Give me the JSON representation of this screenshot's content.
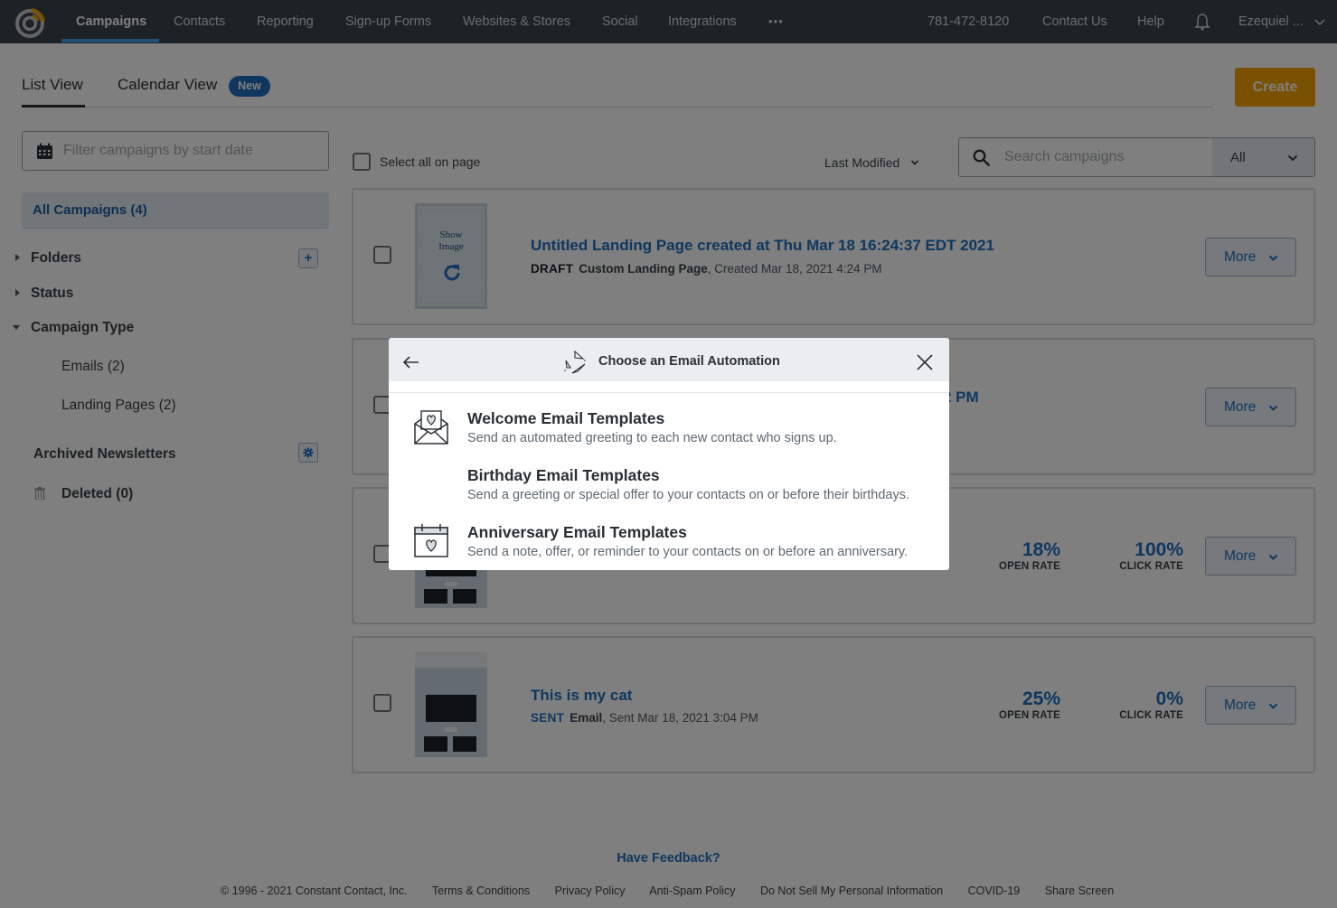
{
  "topnav": {
    "items": [
      "Campaigns",
      "Contacts",
      "Reporting",
      "Sign-up Forms",
      "Websites & Stores",
      "Social",
      "Integrations"
    ],
    "more_icon": "•••",
    "phone": "781-472-8120",
    "contact_us": "Contact Us",
    "help": "Help",
    "user": "Ezequiel ...",
    "active": "Campaigns"
  },
  "tabs": {
    "list_view": "List View",
    "calendar_view": "Calendar View",
    "new_badge": "New",
    "create": "Create"
  },
  "sidebar": {
    "date_filter_placeholder": "Filter campaigns by start date",
    "all_campaigns": "All Campaigns (4)",
    "folders": "Folders",
    "status": "Status",
    "campaign_type": "Campaign Type",
    "emails": "Emails (2)",
    "landing_pages": "Landing Pages (2)",
    "archived": "Archived Newsletters",
    "deleted": "Deleted (0)"
  },
  "list": {
    "select_all": "Select all on page",
    "sort": "Last Modified",
    "search_placeholder": "Search campaigns",
    "filter_value": "All",
    "campaigns": [
      {
        "title": "Untitled Landing Page created at Thu Mar 18 16:24:37 EDT 2021",
        "status": "DRAFT",
        "type": "Custom Landing Page",
        "date": ", Created Mar 18, 2021 4:24 PM",
        "thumb_text_1": "Show",
        "thumb_text_2": "Image",
        "more": "More"
      },
      {
        "title_visible_fragment": "2 PM",
        "more": "More"
      },
      {
        "open_rate": "18%",
        "open_rate_label": "OPEN RATE",
        "click_rate": "100%",
        "click_rate_label": "CLICK RATE",
        "more": "More"
      },
      {
        "title": "This is my cat",
        "status": "SENT",
        "type": "Email",
        "date": ", Sent Mar 18, 2021 3:04 PM",
        "open_rate": "25%",
        "open_rate_label": "OPEN RATE",
        "click_rate": "0%",
        "click_rate_label": "CLICK RATE",
        "more": "More"
      }
    ]
  },
  "footer": {
    "feedback": "Have Feedback?",
    "copyright": "© 1996 - 2021 Constant Contact, Inc.",
    "links": [
      "Terms & Conditions",
      "Privacy Policy",
      "Anti-Spam Policy",
      "Do Not Sell My Personal Information",
      "COVID-19",
      "Share Screen"
    ]
  },
  "modal": {
    "title": "Choose an Email Automation",
    "items": [
      {
        "title": "Welcome Email Templates",
        "description": "Send an automated greeting to each new contact who signs up.",
        "icon": "envelope-heart-icon"
      },
      {
        "title": "Birthday Email Templates",
        "description": "Send a greeting or special offer to your contacts on or before their birthdays.",
        "icon": "none"
      },
      {
        "title": "Anniversary Email Templates",
        "description": "Send a note, offer, or reminder to your contacts on or before an anniversary.",
        "icon": "calendar-heart-icon"
      }
    ]
  },
  "colors": {
    "nav_bg": "#3a454f",
    "accent_blue": "#1f6fbf",
    "create_orange": "#f5a300",
    "logo_orange": "#f5a300"
  }
}
